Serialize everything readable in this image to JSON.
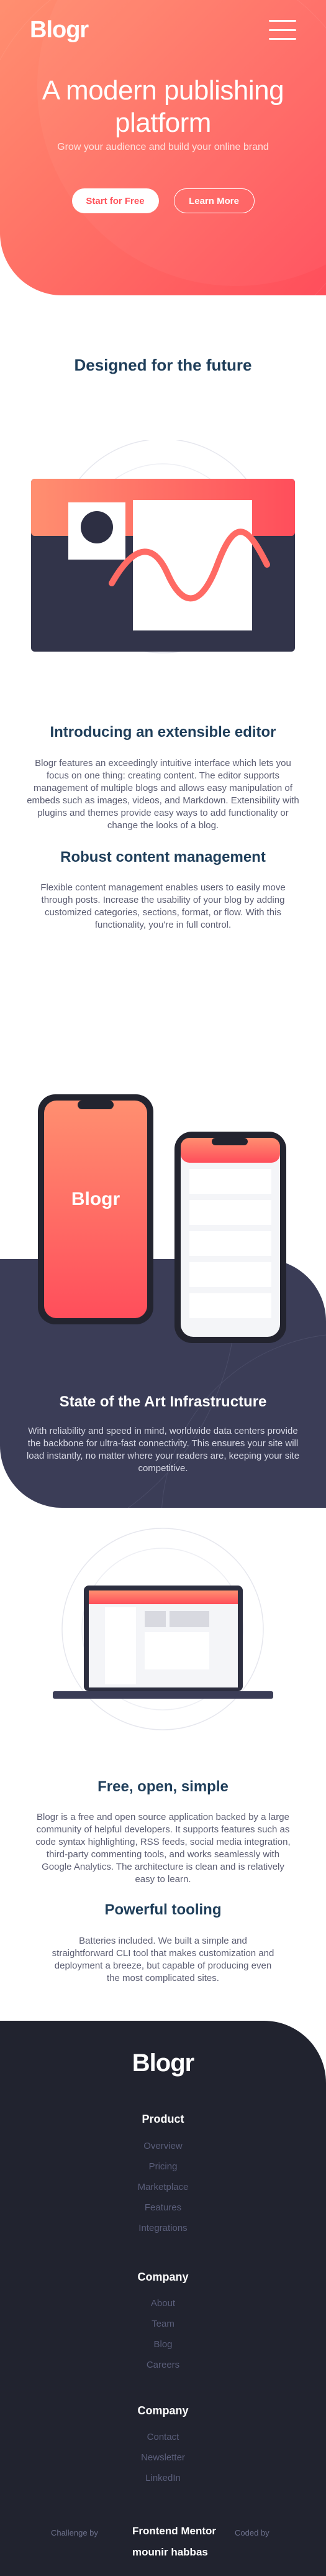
{
  "header": {
    "logo": "Blogr",
    "menu_icon": "hamburger-menu-icon"
  },
  "hero": {
    "title": "A modern publishing platform",
    "subtitle": "Grow your audience and build your online brand",
    "primary_button": "Start for Free",
    "secondary_button": "Learn More"
  },
  "section_future": {
    "heading": "Designed for the future",
    "features": [
      {
        "title": "Introducing an extensible editor",
        "body": "Blogr features an exceedingly intuitive interface which lets you focus on one thing: creating content. The editor supports management of multiple blogs and allows easy manipulation of embeds such as images, videos, and Markdown. Extensibility with plugins and themes provide easy ways to add functionality or change the looks of a blog."
      },
      {
        "title": "Robust content management",
        "body": "Flexible content management enables users to easily move through posts. Increase the usability of your blog by adding customized categories, sections, format, or flow. With this functionality, you're in full control."
      }
    ]
  },
  "section_infra": {
    "phone_logo": "Blogr",
    "title": "State of the Art Infrastructure",
    "body": "With reliability and speed in mind, worldwide data centers provide the backbone for ultra-fast connectivity. This ensures your site will load instantly, no matter where your readers are, keeping your site competitive."
  },
  "section_open": {
    "features": [
      {
        "title": "Free, open, simple",
        "body": "Blogr is a free and open source application backed by a large community of helpful developers. It supports features such as code syntax highlighting, RSS feeds, social media integration, third-party commenting tools, and works seamlessly with Google Analytics. The architecture is clean and is relatively easy to learn."
      },
      {
        "title": "Powerful tooling",
        "body": "Batteries included. We built a simple and straightforward CLI tool that makes customization and deployment a breeze, but capable of producing even the most complicated sites."
      }
    ]
  },
  "footer": {
    "logo": "Blogr",
    "columns": [
      {
        "heading": "Product",
        "links": [
          "Overview",
          "Pricing",
          "Marketplace",
          "Features",
          "Integrations"
        ]
      },
      {
        "heading": "Company",
        "links": [
          "About",
          "Team",
          "Blog",
          "Careers"
        ]
      },
      {
        "heading": "Company",
        "links": [
          "Contact",
          "Newsletter",
          "LinkedIn"
        ]
      }
    ],
    "attribution": {
      "challenge_prefix": "Challenge by",
      "challenge_org": "Frontend Mentor",
      "coded_prefix": "Coded by",
      "author": "mounir habbas"
    }
  },
  "colors": {
    "hero_start": "#ff8f70",
    "hero_end": "#ff4e5b",
    "heading": "#1f3e5a",
    "dark_band": "#3b3d57",
    "footer_bg": "#21232f"
  }
}
